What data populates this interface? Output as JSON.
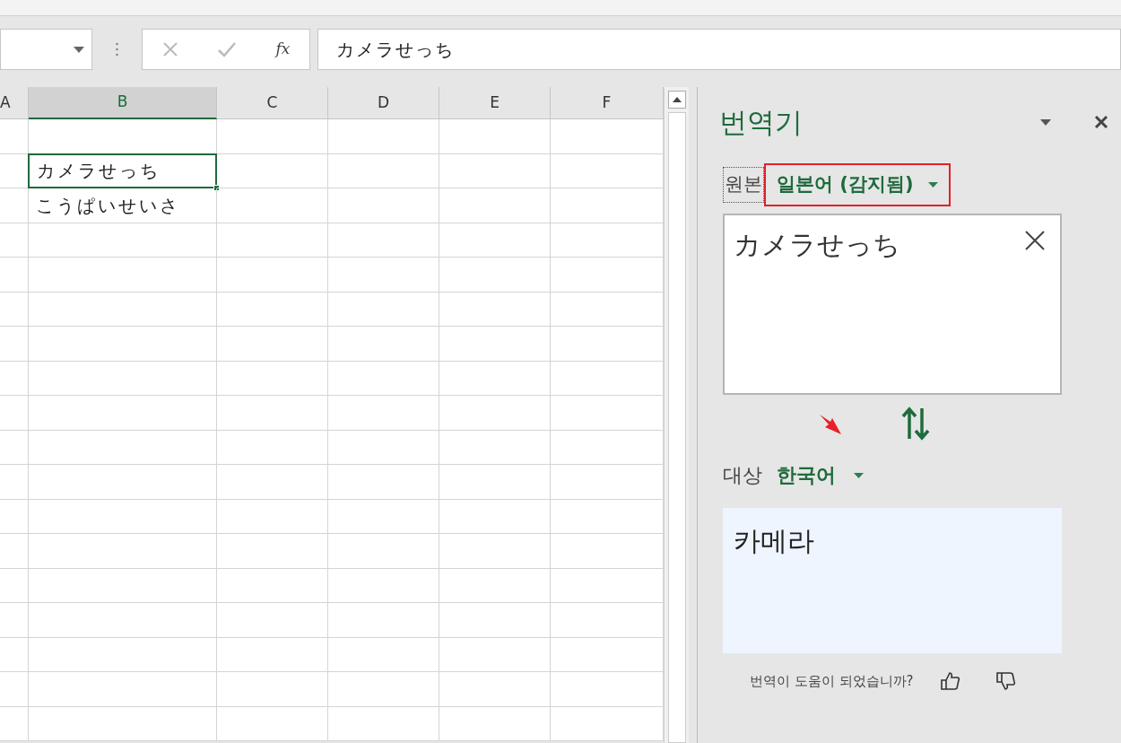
{
  "formula_bar": {
    "function_label": "fx",
    "value": "カメラせっち"
  },
  "grid": {
    "columns": [
      {
        "label": "A",
        "selected": false
      },
      {
        "label": "B",
        "selected": true
      },
      {
        "label": "C",
        "selected": false
      },
      {
        "label": "D",
        "selected": false
      },
      {
        "label": "E",
        "selected": false
      },
      {
        "label": "F",
        "selected": false
      }
    ],
    "cells": [
      {
        "text": "カメラせっち",
        "selected": true
      },
      {
        "text": "こうぱいせいさ",
        "selected": false
      }
    ]
  },
  "translator": {
    "title": "번역기",
    "source_label": "원본",
    "source_language": "일본어 (감지됨)",
    "source_text": "カメラせっち",
    "target_label": "대상",
    "target_language": "한국어",
    "target_text": "카메라",
    "feedback": "번역이 도움이 되었습니까?"
  }
}
